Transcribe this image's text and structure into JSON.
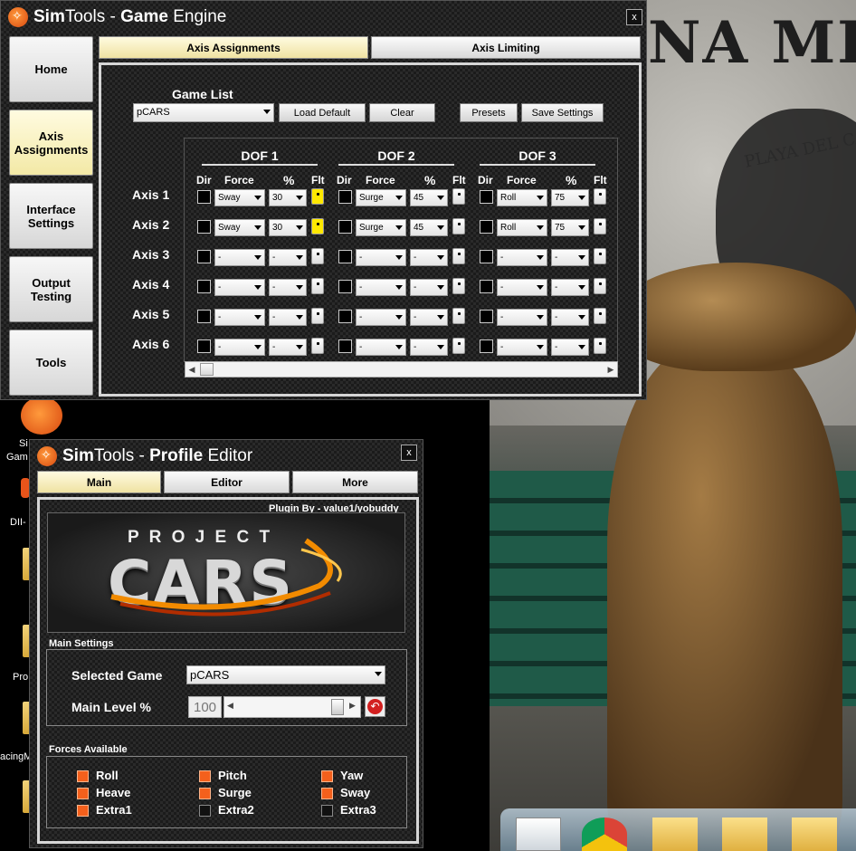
{
  "colors": {
    "accent_yellow": "#ffe800",
    "force_orange": "#f4601c",
    "window_bg": "#1b1b1b"
  },
  "background": {
    "poster_title": "NA MEXI",
    "poster_subtitle": "PLAYA DEL CARME"
  },
  "desktop": {
    "labels": [
      "Si",
      "Gam",
      "DII-",
      "Pro",
      "acingM"
    ]
  },
  "game_engine": {
    "title_prefix": "Sim",
    "title_app": "Tools",
    "title_dash": " - ",
    "title_bold": "Game",
    "title_rest": " Engine",
    "close_label": "x",
    "sidebar": [
      {
        "label": "Home",
        "icon": "home-icon"
      },
      {
        "label": "Axis Assignments",
        "icon": "axis-icon"
      },
      {
        "label": "Interface Settings",
        "icon": "interface-icon"
      },
      {
        "label": "Output Testing",
        "icon": "output-icon"
      },
      {
        "label": "Tools",
        "icon": "tools-icon"
      }
    ],
    "tabs": [
      "Axis Assignments",
      "Axis Limiting"
    ],
    "game_list_label": "Game List",
    "game_selected": "pCARS",
    "buttons": {
      "load_default": "Load Default",
      "clear": "Clear",
      "presets": "Presets",
      "save_settings": "Save Settings"
    },
    "dof_headers": [
      "DOF 1",
      "DOF 2",
      "DOF 3"
    ],
    "col_labels": {
      "dir": "Dir",
      "force": "Force",
      "percent": "%",
      "flt": "Flt"
    },
    "axes": [
      {
        "label": "Axis 1",
        "dofs": [
          {
            "force": "Sway",
            "pct": "30",
            "flt": true
          },
          {
            "force": "Surge",
            "pct": "45",
            "flt": false
          },
          {
            "force": "Roll",
            "pct": "75",
            "flt": false
          }
        ]
      },
      {
        "label": "Axis 2",
        "dofs": [
          {
            "force": "Sway",
            "pct": "30",
            "flt": true
          },
          {
            "force": "Surge",
            "pct": "45",
            "flt": false
          },
          {
            "force": "Roll",
            "pct": "75",
            "flt": false
          }
        ]
      },
      {
        "label": "Axis 3",
        "dofs": [
          {
            "force": "-",
            "pct": "-",
            "flt": false
          },
          {
            "force": "-",
            "pct": "-",
            "flt": false
          },
          {
            "force": "-",
            "pct": "-",
            "flt": false
          }
        ]
      },
      {
        "label": "Axis 4",
        "dofs": [
          {
            "force": "-",
            "pct": "-",
            "flt": false
          },
          {
            "force": "-",
            "pct": "-",
            "flt": false
          },
          {
            "force": "-",
            "pct": "-",
            "flt": false
          }
        ]
      },
      {
        "label": "Axis 5",
        "dofs": [
          {
            "force": "-",
            "pct": "-",
            "flt": false
          },
          {
            "force": "-",
            "pct": "-",
            "flt": false
          },
          {
            "force": "-",
            "pct": "-",
            "flt": false
          }
        ]
      },
      {
        "label": "Axis 6",
        "dofs": [
          {
            "force": "-",
            "pct": "-",
            "flt": false
          },
          {
            "force": "-",
            "pct": "-",
            "flt": false
          },
          {
            "force": "-",
            "pct": "-",
            "flt": false
          }
        ]
      }
    ]
  },
  "profile_editor": {
    "title_prefix": "Sim",
    "title_app": "Tools",
    "title_dash": " - ",
    "title_bold": "Profile",
    "title_rest": " Editor",
    "close_label": "x",
    "tabs": [
      "Main",
      "Editor",
      "More"
    ],
    "plugin_by": "Plugin By - value1/yobuddy",
    "logo_top": "P R O J E C T",
    "logo_main": "CARS",
    "main_settings_title": "Main Settings",
    "selected_game_label": "Selected Game",
    "selected_game_value": "pCARS",
    "main_level_label": "Main Level %",
    "main_level_value": "100",
    "forces_title": "Forces Available",
    "forces": [
      {
        "label": "Roll",
        "on": true
      },
      {
        "label": "Pitch",
        "on": true
      },
      {
        "label": "Yaw",
        "on": true
      },
      {
        "label": "Heave",
        "on": true
      },
      {
        "label": "Surge",
        "on": true
      },
      {
        "label": "Sway",
        "on": true
      },
      {
        "label": "Extra1",
        "on": true
      },
      {
        "label": "Extra2",
        "on": false
      },
      {
        "label": "Extra3",
        "on": false
      }
    ]
  }
}
